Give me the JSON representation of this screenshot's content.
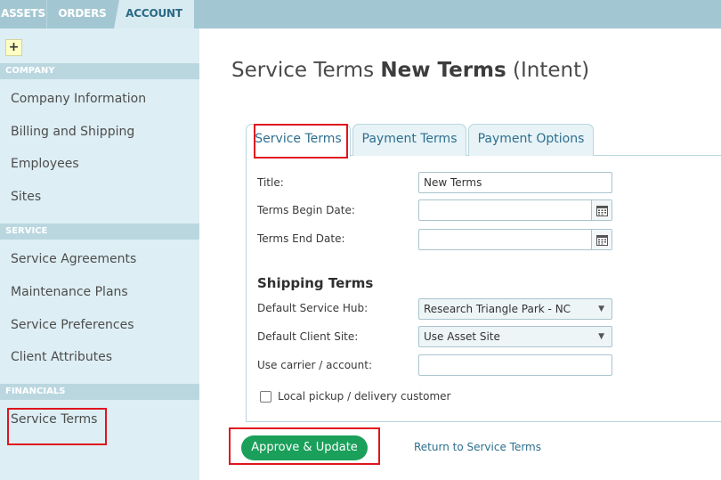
{
  "topnav": {
    "tabs": [
      {
        "label": "ASSETS"
      },
      {
        "label": "ORDERS"
      },
      {
        "label": "ACCOUNT"
      }
    ]
  },
  "sidebar": {
    "add_label": "+",
    "sections": [
      {
        "header": "COMPANY",
        "items": [
          "Company Information",
          "Billing and Shipping",
          "Employees",
          "Sites"
        ]
      },
      {
        "header": "SERVICE",
        "items": [
          "Service Agreements",
          "Maintenance Plans",
          "Service Preferences",
          "Client Attributes"
        ]
      },
      {
        "header": "FINANCIALS",
        "items": [
          "Service Terms"
        ]
      }
    ]
  },
  "page": {
    "title_prefix": "Service Terms ",
    "title_name": "New Terms",
    "title_suffix": " (Intent)"
  },
  "tabs": [
    {
      "label": "Service Terms"
    },
    {
      "label": "Payment Terms"
    },
    {
      "label": "Payment Options"
    }
  ],
  "form": {
    "title_label": "Title:",
    "title_value": "New Terms",
    "begin_label": "Terms Begin Date:",
    "begin_value": "",
    "end_label": "Terms End Date:",
    "end_value": "",
    "shipping_heading": "Shipping Terms",
    "hub_label": "Default Service Hub:",
    "hub_value": "Research Triangle Park - NC",
    "site_label": "Default Client Site:",
    "site_value": "Use Asset Site",
    "carrier_label": "Use carrier / account:",
    "carrier_value": "",
    "pickup_label": "Local pickup / delivery customer"
  },
  "actions": {
    "approve_label": "Approve & Update",
    "return_label": "Return to Service Terms"
  },
  "colors": {
    "accent": "#2e6f8e",
    "approve": "#1aa05a",
    "highlight": "#e0141e"
  }
}
